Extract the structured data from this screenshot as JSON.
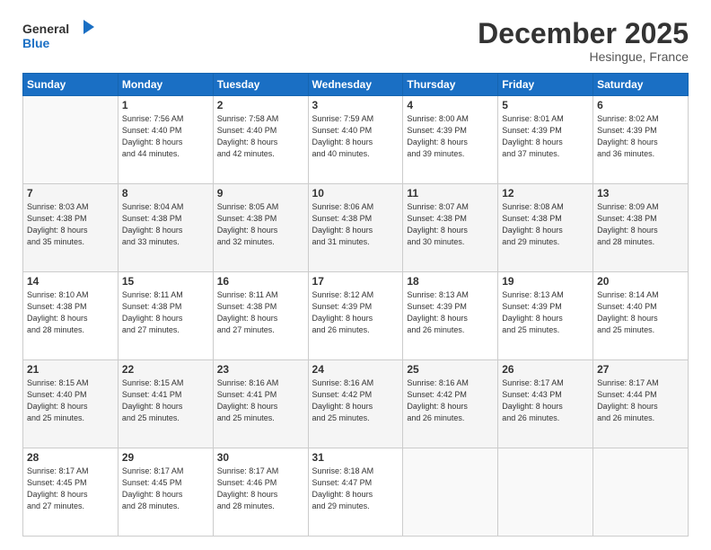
{
  "logo": {
    "line1": "General",
    "line2": "Blue"
  },
  "title": "December 2025",
  "location": "Hesingue, France",
  "days_header": [
    "Sunday",
    "Monday",
    "Tuesday",
    "Wednesday",
    "Thursday",
    "Friday",
    "Saturday"
  ],
  "weeks": [
    [
      {
        "num": "",
        "info": ""
      },
      {
        "num": "1",
        "info": "Sunrise: 7:56 AM\nSunset: 4:40 PM\nDaylight: 8 hours\nand 44 minutes."
      },
      {
        "num": "2",
        "info": "Sunrise: 7:58 AM\nSunset: 4:40 PM\nDaylight: 8 hours\nand 42 minutes."
      },
      {
        "num": "3",
        "info": "Sunrise: 7:59 AM\nSunset: 4:40 PM\nDaylight: 8 hours\nand 40 minutes."
      },
      {
        "num": "4",
        "info": "Sunrise: 8:00 AM\nSunset: 4:39 PM\nDaylight: 8 hours\nand 39 minutes."
      },
      {
        "num": "5",
        "info": "Sunrise: 8:01 AM\nSunset: 4:39 PM\nDaylight: 8 hours\nand 37 minutes."
      },
      {
        "num": "6",
        "info": "Sunrise: 8:02 AM\nSunset: 4:39 PM\nDaylight: 8 hours\nand 36 minutes."
      }
    ],
    [
      {
        "num": "7",
        "info": "Sunrise: 8:03 AM\nSunset: 4:38 PM\nDaylight: 8 hours\nand 35 minutes."
      },
      {
        "num": "8",
        "info": "Sunrise: 8:04 AM\nSunset: 4:38 PM\nDaylight: 8 hours\nand 33 minutes."
      },
      {
        "num": "9",
        "info": "Sunrise: 8:05 AM\nSunset: 4:38 PM\nDaylight: 8 hours\nand 32 minutes."
      },
      {
        "num": "10",
        "info": "Sunrise: 8:06 AM\nSunset: 4:38 PM\nDaylight: 8 hours\nand 31 minutes."
      },
      {
        "num": "11",
        "info": "Sunrise: 8:07 AM\nSunset: 4:38 PM\nDaylight: 8 hours\nand 30 minutes."
      },
      {
        "num": "12",
        "info": "Sunrise: 8:08 AM\nSunset: 4:38 PM\nDaylight: 8 hours\nand 29 minutes."
      },
      {
        "num": "13",
        "info": "Sunrise: 8:09 AM\nSunset: 4:38 PM\nDaylight: 8 hours\nand 28 minutes."
      }
    ],
    [
      {
        "num": "14",
        "info": "Sunrise: 8:10 AM\nSunset: 4:38 PM\nDaylight: 8 hours\nand 28 minutes."
      },
      {
        "num": "15",
        "info": "Sunrise: 8:11 AM\nSunset: 4:38 PM\nDaylight: 8 hours\nand 27 minutes."
      },
      {
        "num": "16",
        "info": "Sunrise: 8:11 AM\nSunset: 4:38 PM\nDaylight: 8 hours\nand 27 minutes."
      },
      {
        "num": "17",
        "info": "Sunrise: 8:12 AM\nSunset: 4:39 PM\nDaylight: 8 hours\nand 26 minutes."
      },
      {
        "num": "18",
        "info": "Sunrise: 8:13 AM\nSunset: 4:39 PM\nDaylight: 8 hours\nand 26 minutes."
      },
      {
        "num": "19",
        "info": "Sunrise: 8:13 AM\nSunset: 4:39 PM\nDaylight: 8 hours\nand 25 minutes."
      },
      {
        "num": "20",
        "info": "Sunrise: 8:14 AM\nSunset: 4:40 PM\nDaylight: 8 hours\nand 25 minutes."
      }
    ],
    [
      {
        "num": "21",
        "info": "Sunrise: 8:15 AM\nSunset: 4:40 PM\nDaylight: 8 hours\nand 25 minutes."
      },
      {
        "num": "22",
        "info": "Sunrise: 8:15 AM\nSunset: 4:41 PM\nDaylight: 8 hours\nand 25 minutes."
      },
      {
        "num": "23",
        "info": "Sunrise: 8:16 AM\nSunset: 4:41 PM\nDaylight: 8 hours\nand 25 minutes."
      },
      {
        "num": "24",
        "info": "Sunrise: 8:16 AM\nSunset: 4:42 PM\nDaylight: 8 hours\nand 25 minutes."
      },
      {
        "num": "25",
        "info": "Sunrise: 8:16 AM\nSunset: 4:42 PM\nDaylight: 8 hours\nand 26 minutes."
      },
      {
        "num": "26",
        "info": "Sunrise: 8:17 AM\nSunset: 4:43 PM\nDaylight: 8 hours\nand 26 minutes."
      },
      {
        "num": "27",
        "info": "Sunrise: 8:17 AM\nSunset: 4:44 PM\nDaylight: 8 hours\nand 26 minutes."
      }
    ],
    [
      {
        "num": "28",
        "info": "Sunrise: 8:17 AM\nSunset: 4:45 PM\nDaylight: 8 hours\nand 27 minutes."
      },
      {
        "num": "29",
        "info": "Sunrise: 8:17 AM\nSunset: 4:45 PM\nDaylight: 8 hours\nand 28 minutes."
      },
      {
        "num": "30",
        "info": "Sunrise: 8:17 AM\nSunset: 4:46 PM\nDaylight: 8 hours\nand 28 minutes."
      },
      {
        "num": "31",
        "info": "Sunrise: 8:18 AM\nSunset: 4:47 PM\nDaylight: 8 hours\nand 29 minutes."
      },
      {
        "num": "",
        "info": ""
      },
      {
        "num": "",
        "info": ""
      },
      {
        "num": "",
        "info": ""
      }
    ]
  ]
}
